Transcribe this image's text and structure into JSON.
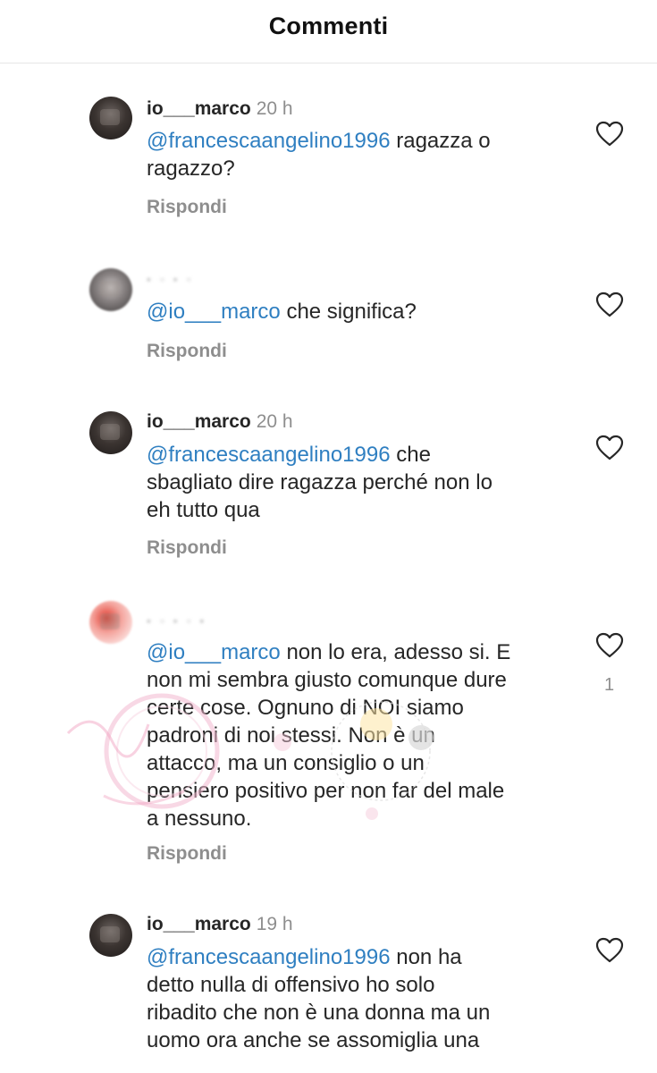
{
  "header": {
    "title": "Commenti"
  },
  "comments": [
    {
      "username": "io___marco",
      "time": "20 h",
      "mention": "@francescaangelino1996",
      "text_lines": [
        "ragazza o",
        "ragazzo?"
      ],
      "reply_label": "Rispondi"
    },
    {
      "mention": "@io___marco",
      "text": "che significa?",
      "reply_label": "Rispondi"
    },
    {
      "username": "io___marco",
      "time": "20 h",
      "mention": "@francescaangelino1996",
      "text_lines": [
        "che",
        "sbagliato dire ragazza perché non lo",
        "eh tutto qua"
      ],
      "reply_label": "Rispondi"
    },
    {
      "mention": "@io___marco",
      "text_lines": [
        "non lo era, adesso si. E",
        "non mi sembra giusto comunque dure",
        "certe cose. Ognuno di NOI siamo",
        "padroni di noi stessi. Non è un",
        "attacco, ma un consiglio o un",
        "pensiero positivo per non far del male",
        "a nessuno."
      ],
      "like_count": "1",
      "reply_label": "Rispondi"
    },
    {
      "username": "io___marco",
      "time": "19 h",
      "mention": "@francescaangelino1996",
      "text_lines": [
        "non ha",
        "detto nulla di offensivo ho solo",
        "ribadito che non è una donna ma un",
        "uomo ora anche se assomiglia una"
      ]
    }
  ],
  "icons": {
    "like": "heart-outline-icon",
    "avatar": "avatar"
  },
  "colors": {
    "mention": "#2f7fc1",
    "secondary": "#8e8e8e",
    "text": "#262626"
  }
}
